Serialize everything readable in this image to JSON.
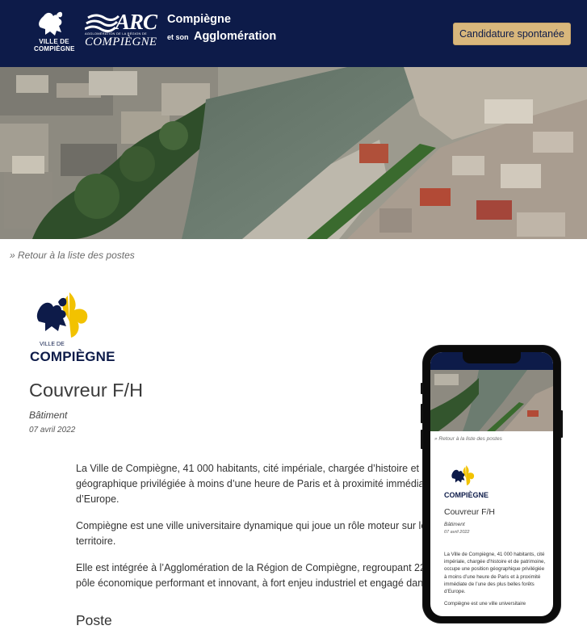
{
  "header": {
    "ville_logo_text": "VILLE DE COMPIÈGNE",
    "arc_logo": {
      "main": "ARC",
      "sub": "AGGLOMÉRATION DE LA RÉGION DE",
      "name": "COMPIÈGNE"
    },
    "brand_line1": "Compiègne",
    "brand_line2_small": "et son",
    "brand_line2_big": "Agglomération",
    "cta_label": "Candidature spontanée",
    "colors": {
      "navy": "#0d1b49",
      "gold": "#d8b77c"
    }
  },
  "back_link": "» Retour à la liste des postes",
  "job": {
    "logo_small": "VILLE DE",
    "logo_name": "COMPIÈGNE",
    "title": "Couvreur F/H",
    "category": "Bâtiment",
    "date": "07 avril 2022",
    "paragraphs": {
      "p1_l1": "La Ville de Compiègne, 41 000 habitants, cité impériale, chargée d’histoire et de",
      "p1_l2": "géographique privilégiée à moins d’une heure de Paris et à proximité immédiate",
      "p1_l3": "d’Europe.",
      "p2_l1": "Compiègne est une ville universitaire dynamique qui joue un rôle moteur sur le d",
      "p2_l2": "territoire.",
      "p3_l1": "Elle est intégrée à l’Agglomération de la Région de Compiègne, regroupant 22 co",
      "p3_l2": "pôle économique performant et innovant, à fort enjeu industriel et engagé dans le"
    },
    "section_title": "Poste"
  },
  "mobile": {
    "back_link": "» Retour à la liste des postes",
    "logo_name": "COMPIÈGNE",
    "title": "Couvreur F/H",
    "category": "Bâtiment",
    "date": "07 avril 2022",
    "p1": "La Ville de Compiègne, 41 000 habitants, cité impériale, chargée d’histoire et de patrimoine, occupe une position géographique privilégiée à moins d’une heure de Paris et à proximité immédiate de l’une des plus belles forêts d’Europe.",
    "p2": "Compiègne est une ville universitaire"
  }
}
